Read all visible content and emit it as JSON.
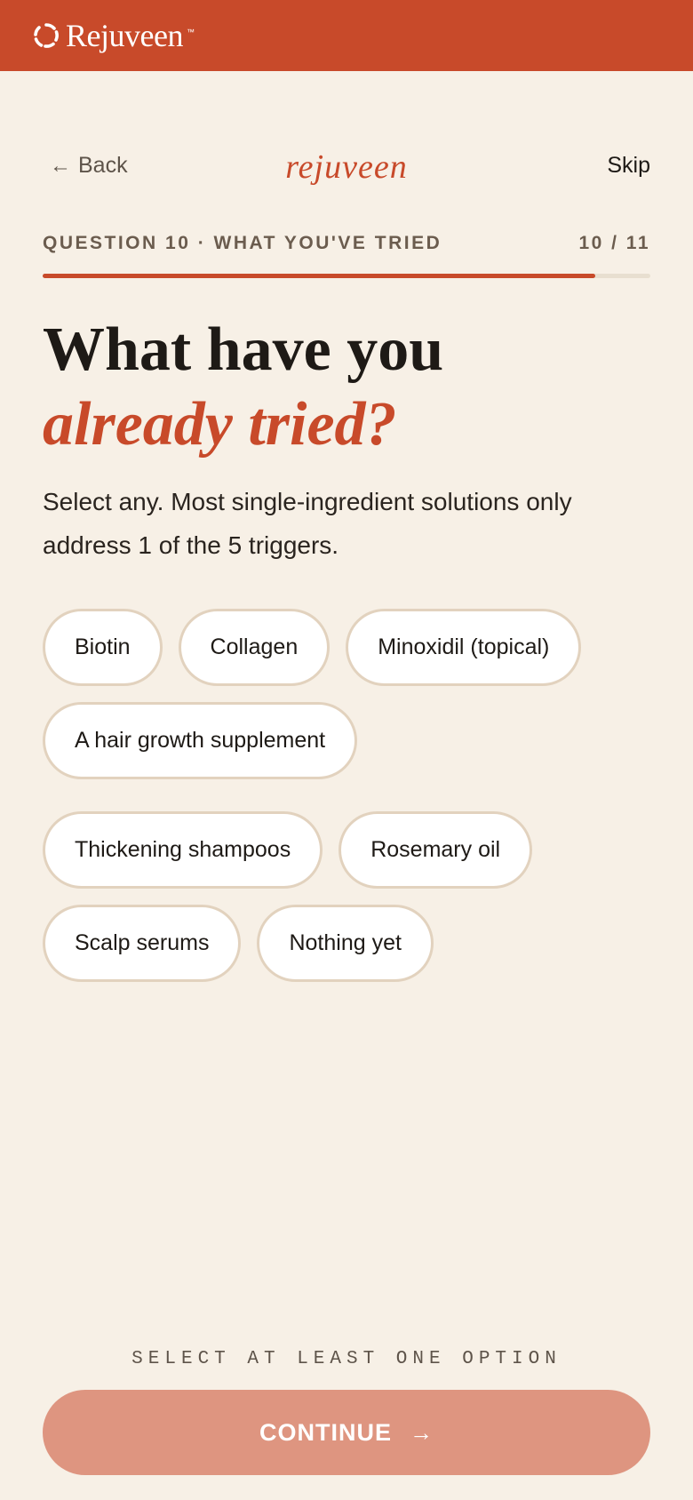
{
  "brand": {
    "name": "Rejuveen",
    "trademark": "™",
    "icon": "ring-logo-icon",
    "bar_color": "#C84A2A"
  },
  "nav": {
    "back_label": "Back",
    "back_icon": "arrow-left-icon",
    "wordmark": "rejuveen",
    "skip_label": "Skip"
  },
  "question": {
    "label": "QUESTION 10 · WHAT YOU'VE TRIED",
    "counter": "10 / 11",
    "progress": 0.909,
    "headline_line1": "What have you",
    "headline_line2": "already tried?",
    "subtitle": "Select any. Most single-ingredient solutions only address 1 of the 5 triggers."
  },
  "options": [
    {
      "label": "Biotin",
      "selected": false
    },
    {
      "label": "Collagen",
      "selected": false
    },
    {
      "label": "Minoxidil (topical)",
      "selected": false
    },
    {
      "label": "A hair growth supplement",
      "selected": false
    },
    {
      "label": "Thickening shampoos",
      "selected": false
    },
    {
      "label": "Rosemary oil",
      "selected": false
    },
    {
      "label": "Scalp serums",
      "selected": false
    },
    {
      "label": "Nothing yet",
      "selected": false
    }
  ],
  "footer": {
    "hint": "SELECT AT LEAST ONE OPTION",
    "continue_label": "CONTINUE",
    "continue_icon": "arrow-right-icon"
  },
  "colors": {
    "accent": "#C84A2A",
    "background": "#F7F0E6",
    "button_disabled": "#DE9580",
    "chip_border": "#E2D2BE"
  }
}
